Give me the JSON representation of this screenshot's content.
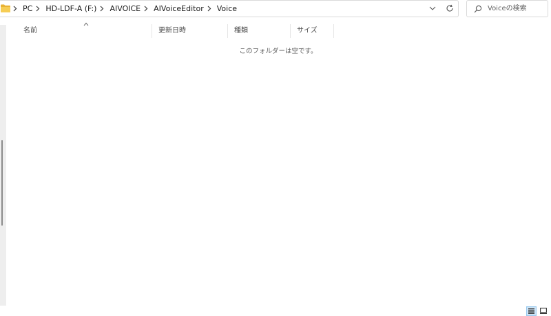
{
  "breadcrumb": {
    "items": [
      "PC",
      "HD-LDF-A (F:)",
      "AIVOICE",
      "AIVoiceEditor",
      "Voice"
    ]
  },
  "search": {
    "placeholder": "Voiceの検索"
  },
  "columns": {
    "name": "名前",
    "date_modified": "更新日時",
    "type": "種類",
    "size": "サイズ"
  },
  "empty_message": "このフォルダーは空です。",
  "icons": {
    "folder": "folder-icon",
    "chevron": "chevron-right-icon",
    "dropdown": "chevron-down-icon",
    "refresh": "refresh-icon",
    "search": "search-icon",
    "sort": "sort-ascending-icon",
    "details_view": "details-view-icon",
    "tiles_view": "large-icons-view-icon"
  },
  "colors": {
    "folder": "#f4c542",
    "selected_view": "#cce4f7"
  }
}
